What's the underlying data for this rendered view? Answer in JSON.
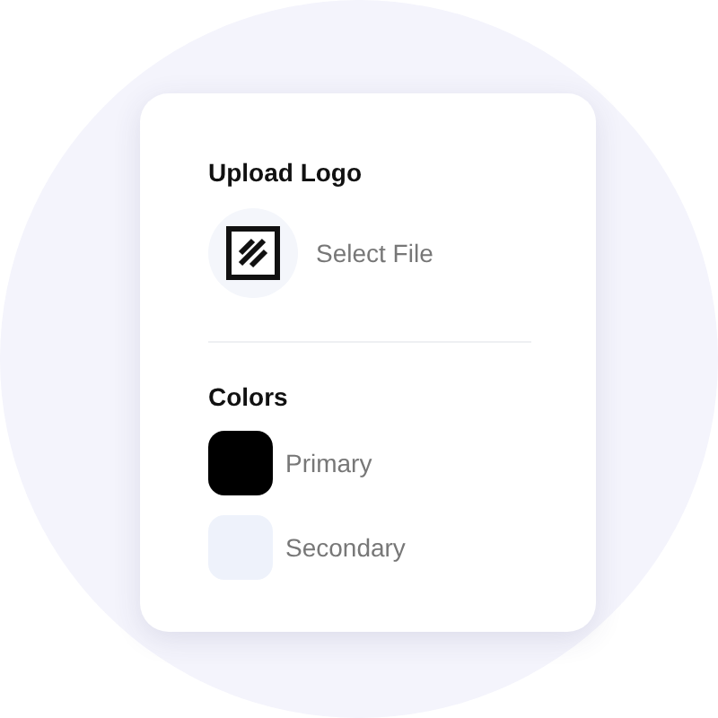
{
  "upload_logo": {
    "title": "Upload Logo",
    "button": "Select File"
  },
  "colors": {
    "title": "Colors",
    "items": [
      {
        "label": "Primary",
        "color": "#000000"
      },
      {
        "label": "Secondary",
        "color": "#eef2fb"
      }
    ]
  }
}
